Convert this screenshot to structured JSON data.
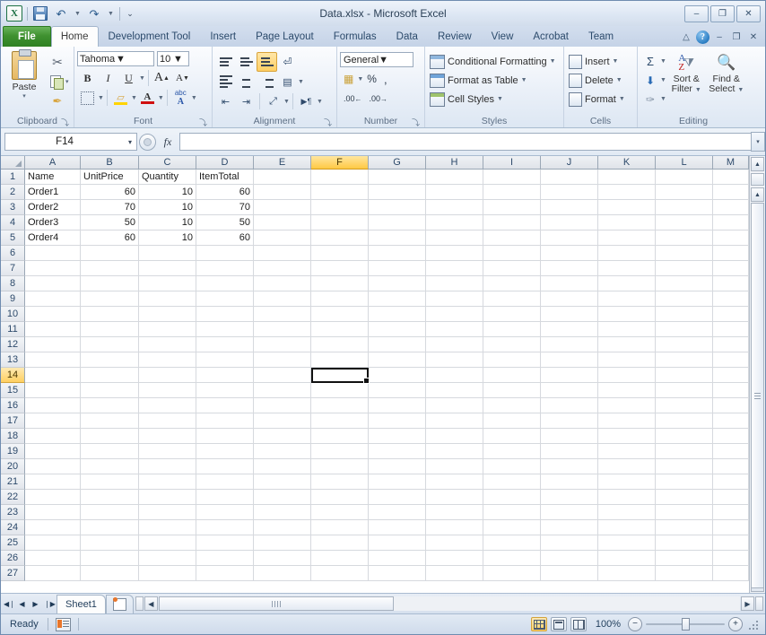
{
  "window": {
    "title": "Data.xlsx  -  Microsoft Excel",
    "minimize": "–",
    "restore": "❐",
    "close": "✕"
  },
  "quick_access": {
    "logo": "X",
    "save": "save-icon",
    "undo": "↶",
    "redo": "↷",
    "customize": "▾"
  },
  "tabs": [
    {
      "label": "File",
      "active": false,
      "file": true
    },
    {
      "label": "Home",
      "active": true
    },
    {
      "label": "Development Tool",
      "active": false
    },
    {
      "label": "Insert",
      "active": false
    },
    {
      "label": "Page Layout",
      "active": false
    },
    {
      "label": "Formulas",
      "active": false
    },
    {
      "label": "Data",
      "active": false
    },
    {
      "label": "Review",
      "active": false
    },
    {
      "label": "View",
      "active": false
    },
    {
      "label": "Acrobat",
      "active": false
    },
    {
      "label": "Team",
      "active": false
    }
  ],
  "tab_right": {
    "collapse_ribbon": "△",
    "help": "?",
    "minimize": "–",
    "restore": "❐",
    "close": "✕"
  },
  "ribbon": {
    "clipboard": {
      "label": "Clipboard",
      "paste": "Paste",
      "paste_caret": "▾",
      "cut": "✂",
      "copy": "copy-icon",
      "format_painter": "✒",
      "dropdown": "▾",
      "dialog_launcher": "⤵"
    },
    "font": {
      "label": "Font",
      "font_name": "Tahoma",
      "font_size": "10",
      "bold": "B",
      "italic": "I",
      "underline": "U",
      "grow_font": "A",
      "shrink_font": "A",
      "borders": "borders-icon",
      "fill_color": "fill-color-icon",
      "font_color": "A",
      "phonetic": "abc",
      "caret": "▾",
      "dialog_launcher": "⤵"
    },
    "alignment": {
      "label": "Alignment",
      "align_top": "align-top-icon",
      "align_middle": "align-middle-icon",
      "align_bottom": "align-bottom-icon",
      "wrap_text": "wrap-text-icon",
      "align_left": "align-left-icon",
      "align_center": "align-center-icon",
      "align_right": "align-right-icon",
      "merge_center": "merge-center-icon",
      "decrease_indent": "decrease-indent-icon",
      "increase_indent": "increase-indent-icon",
      "orientation": "orientation-icon",
      "text_direction": "▶¶",
      "caret": "▾",
      "dialog_launcher": "⤵"
    },
    "number": {
      "label": "Number",
      "format": "General",
      "accounting": "accounting-icon",
      "percent": "%",
      "comma": ",",
      "increase_decimal": ".00",
      "decrease_decimal": ".00",
      "caret": "▾",
      "dialog_launcher": "⤵"
    },
    "styles": {
      "label": "Styles",
      "conditional_formatting": "Conditional Formatting",
      "format_as_table": "Format as Table",
      "cell_styles": "Cell Styles",
      "caret": "▾"
    },
    "cells": {
      "label": "Cells",
      "insert": "Insert",
      "delete": "Delete",
      "format": "Format",
      "caret": "▾"
    },
    "editing": {
      "label": "Editing",
      "autosum": "Σ",
      "fill": "⬇",
      "clear": "✑",
      "sort_filter_line1": "Sort &",
      "sort_filter_line2": "Filter",
      "find_select_line1": "Find &",
      "find_select_line2": "Select",
      "sort_az_a": "A",
      "sort_az_z": "Z",
      "caret": "▾"
    }
  },
  "formula_bar": {
    "name_box": "F14",
    "name_box_caret": "▾",
    "cancel_accept": "circle-button",
    "fx": "fx",
    "value": "",
    "expand": "▾"
  },
  "grid": {
    "select_all": "select-all-corner",
    "columns": [
      {
        "label": "A",
        "width": 62,
        "selected": false
      },
      {
        "label": "B",
        "width": 65,
        "selected": false
      },
      {
        "label": "C",
        "width": 64,
        "selected": false
      },
      {
        "label": "D",
        "width": 64,
        "selected": false
      },
      {
        "label": "E",
        "width": 64,
        "selected": false
      },
      {
        "label": "F",
        "width": 64,
        "selected": true
      },
      {
        "label": "G",
        "width": 64,
        "selected": false
      },
      {
        "label": "H",
        "width": 64,
        "selected": false
      },
      {
        "label": "I",
        "width": 64,
        "selected": false
      },
      {
        "label": "J",
        "width": 64,
        "selected": false
      },
      {
        "label": "K",
        "width": 64,
        "selected": false
      },
      {
        "label": "L",
        "width": 64,
        "selected": false
      },
      {
        "label": "M",
        "width": 40,
        "selected": false
      }
    ],
    "rows": [
      {
        "num": "1",
        "selected": false
      },
      {
        "num": "2",
        "selected": false
      },
      {
        "num": "3",
        "selected": false
      },
      {
        "num": "4",
        "selected": false
      },
      {
        "num": "5",
        "selected": false
      },
      {
        "num": "6",
        "selected": false
      },
      {
        "num": "7",
        "selected": false
      },
      {
        "num": "8",
        "selected": false
      },
      {
        "num": "9",
        "selected": false
      },
      {
        "num": "10",
        "selected": false
      },
      {
        "num": "11",
        "selected": false
      },
      {
        "num": "12",
        "selected": false
      },
      {
        "num": "13",
        "selected": false
      },
      {
        "num": "14",
        "selected": true
      },
      {
        "num": "15",
        "selected": false
      },
      {
        "num": "16",
        "selected": false
      },
      {
        "num": "17",
        "selected": false
      },
      {
        "num": "18",
        "selected": false
      },
      {
        "num": "19",
        "selected": false
      },
      {
        "num": "20",
        "selected": false
      },
      {
        "num": "21",
        "selected": false
      },
      {
        "num": "22",
        "selected": false
      },
      {
        "num": "23",
        "selected": false
      },
      {
        "num": "24",
        "selected": false
      },
      {
        "num": "25",
        "selected": false
      },
      {
        "num": "26",
        "selected": false
      },
      {
        "num": "27",
        "selected": false
      }
    ],
    "data": [
      [
        "Name",
        "UnitPrice",
        "Quantity",
        "ItemTotal"
      ],
      [
        "Order1",
        "60",
        "10",
        "60"
      ],
      [
        "Order2",
        "70",
        "10",
        "70"
      ],
      [
        "Order3",
        "50",
        "10",
        "50"
      ],
      [
        "Order4",
        "60",
        "10",
        "60"
      ]
    ],
    "numeric_columns": [
      1,
      2,
      3
    ],
    "active_cell": "F14"
  },
  "sheet_tabs": {
    "first": "◀❘",
    "prev": "◀",
    "next": "▶",
    "last": "❘▶",
    "sheets": [
      "Sheet1"
    ],
    "new_sheet": "insert-worksheet-icon"
  },
  "status_bar": {
    "status": "Ready",
    "macro_record": "record-macro-icon",
    "view_normal": "normal-view-icon",
    "view_page_layout": "page-layout-view-icon",
    "view_page_break": "page-break-view-icon",
    "zoom": "100%",
    "zoom_out": "−",
    "zoom_in": "+"
  },
  "colors": {
    "accent_green": "#3f9130",
    "selection_yellow": "#ffc943",
    "ribbon_bg": "#eaf0f8",
    "header_text": "#2d4a6b"
  }
}
